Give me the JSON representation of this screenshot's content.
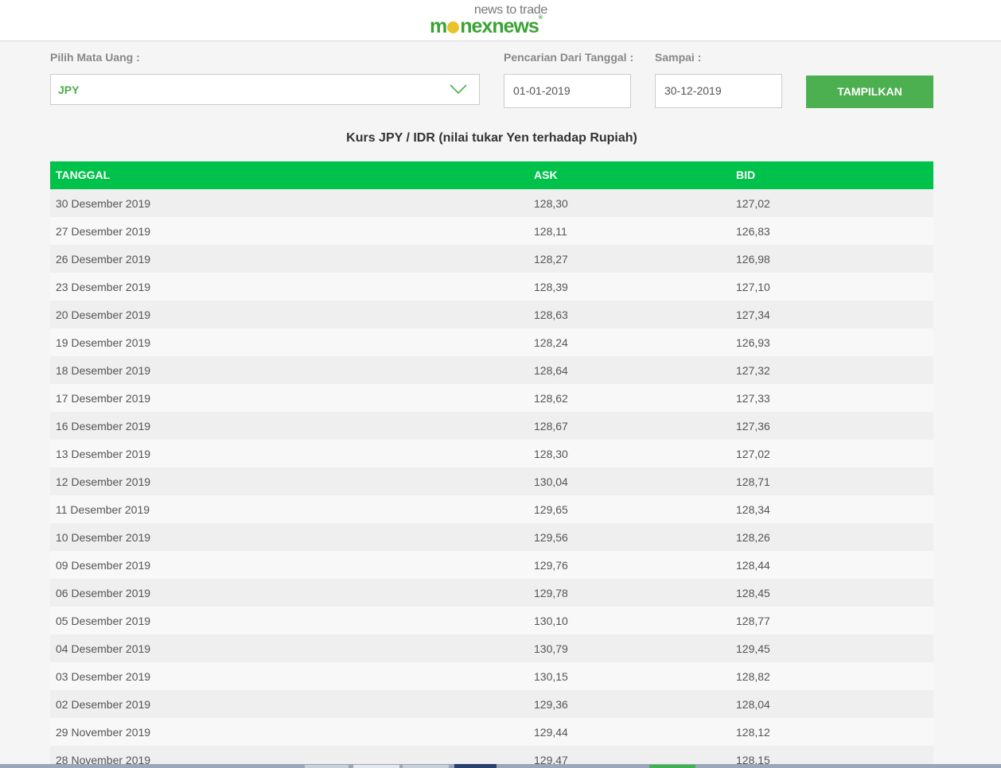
{
  "header": {
    "tagline": "news to trade",
    "brand_pre": "m",
    "brand_post": "nexnews",
    "brand_reg": "®"
  },
  "form": {
    "currency_label": "Pilih Mata Uang :",
    "currency_value": "JPY",
    "from_label": "Pencarian Dari Tanggal :",
    "from_value": "01-01-2019",
    "to_label": "Sampai :",
    "to_value": "30-12-2019",
    "submit_label": "TAMPILKAN"
  },
  "caption": "Kurs JPY / IDR (nilai tukar Yen terhadap Rupiah)",
  "table": {
    "headers": [
      "TANGGAL",
      "ASK",
      "BID"
    ],
    "rows": [
      [
        "30 Desember 2019",
        "128,30",
        "127,02"
      ],
      [
        "27 Desember 2019",
        "128,11",
        "126,83"
      ],
      [
        "26 Desember 2019",
        "128,27",
        "126,98"
      ],
      [
        "23 Desember 2019",
        "128,39",
        "127,10"
      ],
      [
        "20 Desember 2019",
        "128,63",
        "127,34"
      ],
      [
        "19 Desember 2019",
        "128,24",
        "126,93"
      ],
      [
        "18 Desember 2019",
        "128,64",
        "127,32"
      ],
      [
        "17 Desember 2019",
        "128,62",
        "127,33"
      ],
      [
        "16 Desember 2019",
        "128,67",
        "127,36"
      ],
      [
        "13 Desember 2019",
        "128,30",
        "127,02"
      ],
      [
        "12 Desember 2019",
        "130,04",
        "128,71"
      ],
      [
        "11 Desember 2019",
        "129,65",
        "128,34"
      ],
      [
        "10 Desember 2019",
        "129,56",
        "128,26"
      ],
      [
        "09 Desember 2019",
        "129,76",
        "128,44"
      ],
      [
        "06 Desember 2019",
        "129,78",
        "128,45"
      ],
      [
        "05 Desember 2019",
        "130,10",
        "128,77"
      ],
      [
        "04 Desember 2019",
        "130,79",
        "129,45"
      ],
      [
        "03 Desember 2019",
        "130,15",
        "128,82"
      ],
      [
        "02 Desember 2019",
        "129,36",
        "128,04"
      ],
      [
        "29 November 2019",
        "129,44",
        "128,12"
      ],
      [
        "28 November 2019",
        "129,47",
        "128,15"
      ]
    ]
  },
  "colors": {
    "accent": "#4caf50",
    "table_header": "#00c24a",
    "brand": "#3aa335"
  }
}
